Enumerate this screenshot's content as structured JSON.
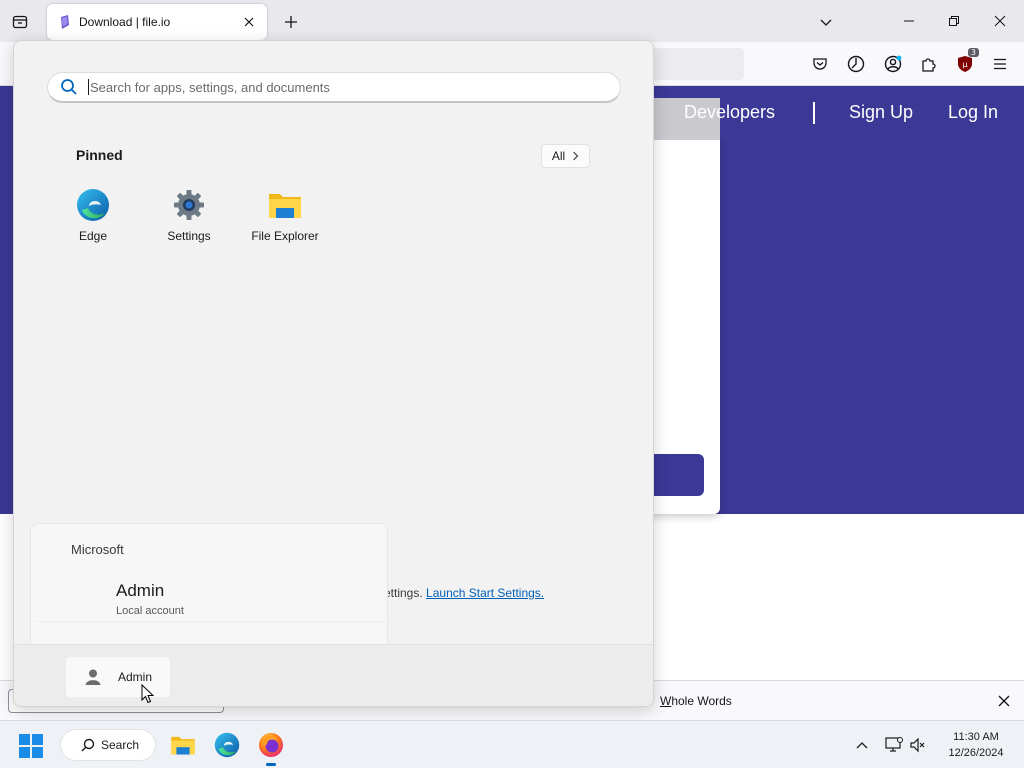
{
  "browser": {
    "tab_title": "Download | file.io"
  },
  "website": {
    "nav": {
      "developers": "Developers",
      "sign_up": "Sign Up",
      "log_in": "Log In"
    },
    "brand_color": "#3b3896"
  },
  "findbar": {
    "whole_words_label": "Whole Words",
    "whole_words_accesskey": "W",
    "whole_words_rest": "hole Words"
  },
  "start_menu": {
    "search_placeholder": "Search for apps, settings, and documents",
    "pinned_title": "Pinned",
    "all_button": "All",
    "pinned_apps": [
      {
        "label": "Edge",
        "icon": "edge-icon"
      },
      {
        "label": "Settings",
        "icon": "settings-gear-icon"
      },
      {
        "label": "File Explorer",
        "icon": "folder-icon"
      }
    ],
    "recommended_text": "ettings.",
    "launch_settings_link": "Launch Start Settings.",
    "account_flyout": {
      "organization": "Microsoft",
      "user_name": "Admin",
      "account_type": "Local account"
    },
    "footer_user": "Admin"
  },
  "taskbar": {
    "search_label": "Search",
    "time": "11:30 AM",
    "date": "12/26/2024"
  },
  "ublock_count": "3"
}
